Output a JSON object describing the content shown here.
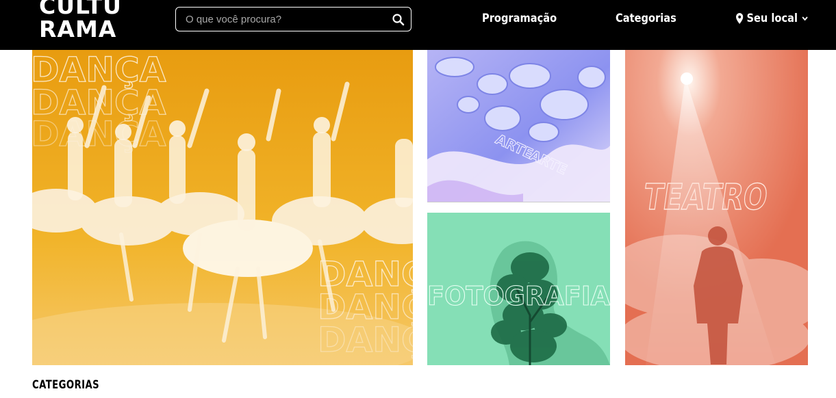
{
  "header": {
    "logo": {
      "line1": "CULTU",
      "line2": "RAMA"
    },
    "search": {
      "placeholder": "O que você procura?",
      "icon": "search-icon"
    },
    "nav": {
      "programacao": "Programação",
      "categorias": "Categorias",
      "local": "Seu local",
      "local_icon": "location-pin-icon",
      "dropdown_icon": "chevron-down-icon"
    }
  },
  "tiles": [
    {
      "name": "Dança",
      "color": "#eba514",
      "overlay_text": "DANÇA"
    },
    {
      "name": "Arte",
      "color": "#bfb7f6",
      "overlay_text": "ARTE"
    },
    {
      "name": "Fotografia",
      "color": "#85dfb6",
      "overlay_text": "FOTOGRAFIA"
    },
    {
      "name": "Teatro",
      "color": "#e8775b",
      "overlay_text": "TEATRO"
    }
  ],
  "sections": {
    "categorias_title": "CATEGORIAS"
  }
}
